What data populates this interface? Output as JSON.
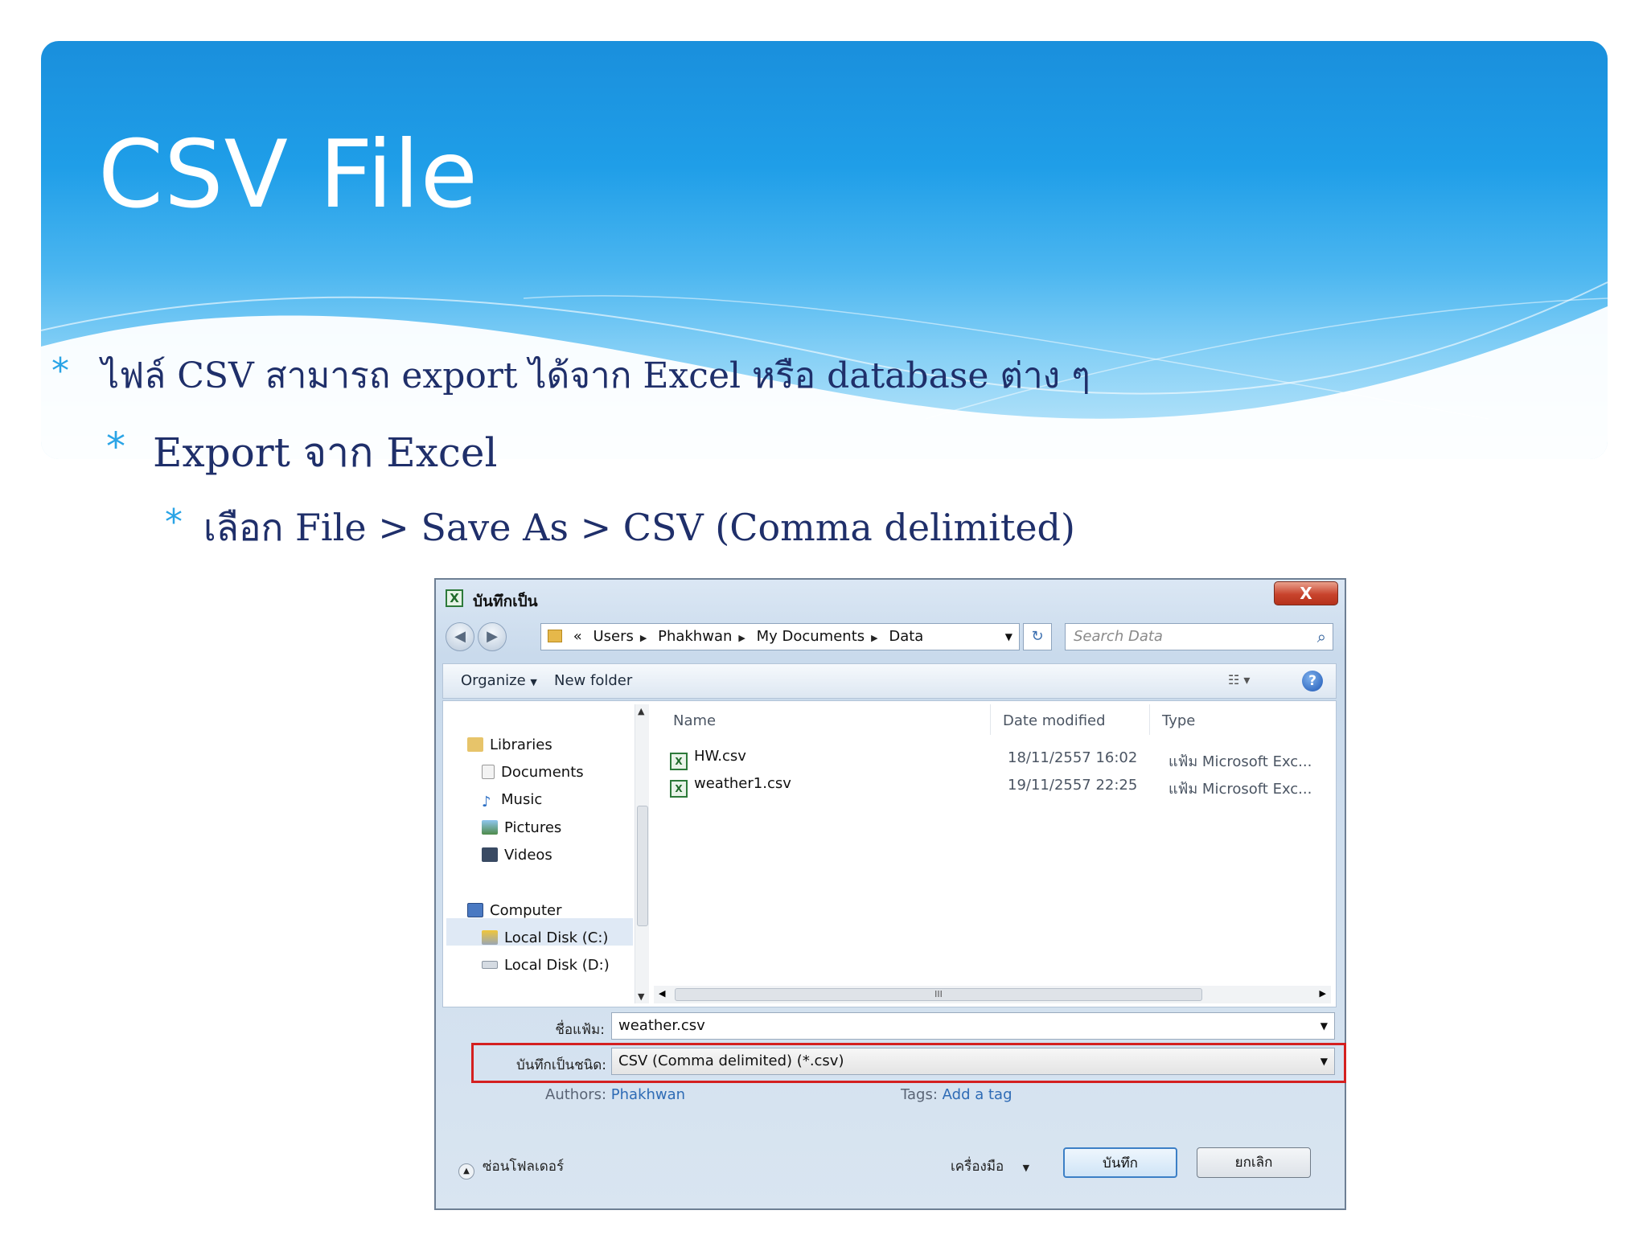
{
  "slide": {
    "title": "CSV File",
    "bullets": [
      "ไฟล์ CSV สามารถ export ได้จาก Excel หรือ database ต่าง ๆ",
      "Export จาก Excel",
      "เลือก File > Save As > CSV (Comma delimited)"
    ],
    "bullet_symbol": "*"
  },
  "dialog": {
    "window_title": "บันทึกเป็น",
    "close_label": "X",
    "address": {
      "prefix": "«",
      "segments": [
        "Users",
        "Phakhwan",
        "My Documents",
        "Data"
      ]
    },
    "search_placeholder": "Search Data",
    "toolbar": {
      "organize": "Organize",
      "new_folder": "New folder",
      "help": "?"
    },
    "nav": {
      "libraries": "Libraries",
      "documents": "Documents",
      "music": "Music",
      "pictures": "Pictures",
      "videos": "Videos",
      "computer": "Computer",
      "local_c": "Local Disk (C:)",
      "local_d": "Local Disk (D:)"
    },
    "columns": {
      "name": "Name",
      "date": "Date modified",
      "type": "Type"
    },
    "files": [
      {
        "name": "HW.csv",
        "date": "18/11/2557 16:02",
        "type": "แฟ้ม Microsoft Exc..."
      },
      {
        "name": "weather1.csv",
        "date": "19/11/2557 22:25",
        "type": "แฟ้ม Microsoft Exc..."
      }
    ],
    "filename_label": "ชื่อแฟ้ม:",
    "filename_value": "weather.csv",
    "savetype_label": "บันทึกเป็นชนิด:",
    "savetype_value": "CSV (Comma delimited) (*.csv)",
    "authors_label": "Authors:",
    "authors_value": "Phakhwan",
    "tags_label": "Tags:",
    "tags_value": "Add a tag",
    "hide_folders": "ซ่อนโฟลเดอร์",
    "tools": "เครื่องมือ",
    "save_button": "บันทึก",
    "cancel_button": "ยกเลิก",
    "accent_colors": {
      "highlight": "#d42020",
      "link": "#2e6bb5",
      "banner": "#1f9ee8"
    }
  }
}
